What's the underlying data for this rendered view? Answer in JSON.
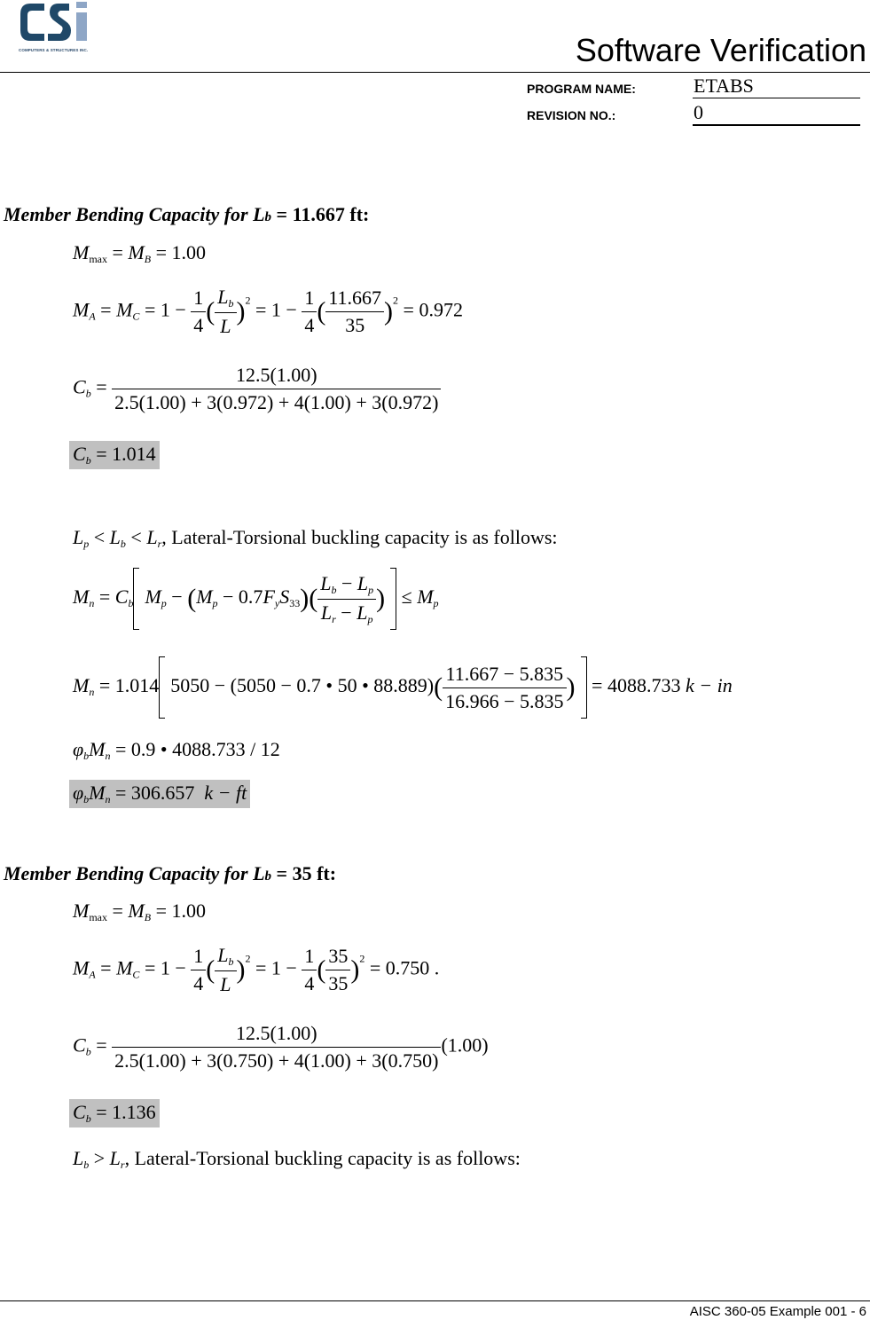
{
  "header": {
    "logo_text": "CSI",
    "logo_subtitle": "COMPUTERS & STRUCTURES INC.",
    "title": "Software Verification",
    "program_name_label": "PROGRAM NAME:",
    "program_name_value": "ETABS",
    "revision_label": "REVISION NO.:",
    "revision_value": "0"
  },
  "colors": {
    "logo_dark": "#1f4868",
    "logo_light": "#8ea6c6",
    "highlight": "#c0c0c0"
  },
  "section1": {
    "heading_prefix": "Member Bending Capacity for L",
    "heading_sub": "b",
    "heading_suffix": " = 11.667 ft:",
    "mmax_rhs": "= 1.00",
    "ma_value": "11.667",
    "ma_den": "35",
    "ma_result": "= 0.972",
    "cb_num": "12.5(1.00)",
    "cb_den": "2.5(1.00) + 3(0.972) + 4(1.00) + 3(0.972)",
    "cb_result": "= 1.014",
    "condition_text": ", Lateral-Torsional buckling capacity is as follows:",
    "mn_calc_prefix": "= 1.014",
    "mn_calc_inner": "5050 − (5050 − 0.7 • 50 • 88.889)",
    "mn_calc_num": "11.667 − 5.835",
    "mn_calc_den": "16.966 − 5.835",
    "mn_calc_result": "= 4088.733",
    "mn_unit": "k − in",
    "phimn_calc": "= 0.9 • 4088.733 / 12",
    "phimn_result": "= 306.657",
    "phimn_unit": "k − ft"
  },
  "section2": {
    "heading_prefix": "Member Bending Capacity for L",
    "heading_sub": "b",
    "heading_suffix": " = 35 ft:",
    "mmax_rhs": "= 1.00",
    "ma_value": "35",
    "ma_den": "35",
    "ma_result": "= 0.750 .",
    "cb_num": "12.5(1.00)",
    "cb_den": "2.5(1.00) + 3(0.750) + 4(1.00) + 3(0.750)",
    "cb_factor": "(1.00)",
    "cb_result": "= 1.136",
    "condition_text": ", Lateral-Torsional buckling capacity is as follows:"
  },
  "footer": {
    "page_label": "AISC 360-05 Example 001 - 6"
  }
}
